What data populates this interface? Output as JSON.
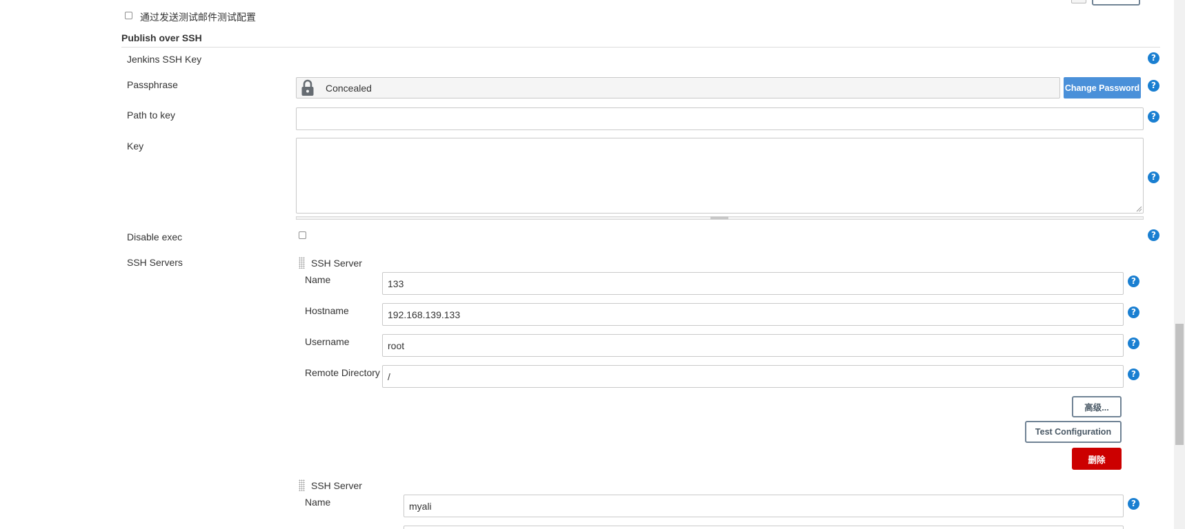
{
  "email_test": {
    "checkbox_label": "通过发送测试邮件测试配置"
  },
  "publish_over_ssh": {
    "title": "Publish over SSH",
    "jenkins_ssh_key_label": "Jenkins SSH Key",
    "passphrase": {
      "label": "Passphrase",
      "value": "Concealed",
      "change_button": "Change Password"
    },
    "path_to_key": {
      "label": "Path to key",
      "value": ""
    },
    "key": {
      "label": "Key",
      "value": ""
    },
    "disable_exec": {
      "label": "Disable exec",
      "checked": false
    },
    "ssh_servers_label": "SSH Servers",
    "servers": [
      {
        "header": "SSH Server",
        "name_label": "Name",
        "name": "133",
        "hostname_label": "Hostname",
        "hostname": "192.168.139.133",
        "username_label": "Username",
        "username": "root",
        "remote_directory_label": "Remote Directory",
        "remote_directory": "/",
        "advanced_button": "高级...",
        "test_button": "Test Configuration",
        "delete_button": "删除"
      },
      {
        "header": "SSH Server",
        "name_label": "Name",
        "name": "myali"
      }
    ]
  },
  "help_icon_glyph": "?",
  "colors": {
    "help_icon": "#1a7fd1",
    "primary_button": "#4a90d9",
    "danger_button": "#cc0000",
    "section_line": "#dcdcdc"
  }
}
